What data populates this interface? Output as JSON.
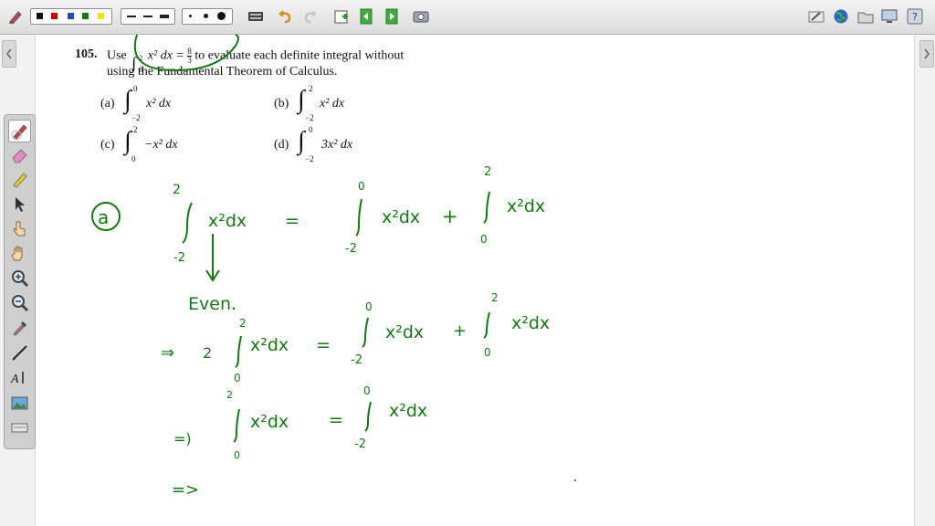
{
  "toolbar": {
    "pen_colors": [
      "#111111",
      "#d40000",
      "#1a4fbf",
      "#137a13",
      "#f2e600"
    ],
    "icons": [
      "pen-settings-icon",
      "keyboard-icon",
      "undo-icon",
      "redo-icon",
      "insert-page-icon",
      "page-back-icon",
      "page-forward-icon",
      "screen-capture-icon",
      "hide-screen-icon",
      "globe-icon",
      "folder-icon",
      "display-icon",
      "help-icon"
    ]
  },
  "side_tools": [
    "pen-icon",
    "eraser-icon",
    "highlighter-icon",
    "select-arrow-icon",
    "pointer-hand-icon",
    "pan-hand-icon",
    "zoom-in-icon",
    "zoom-out-icon",
    "eyedropper-icon",
    "line-icon",
    "text-tool-icon",
    "image-icon",
    "shape-icon"
  ],
  "problem": {
    "number": "105.",
    "line1_prefix": "Use",
    "given_sup": "2",
    "given_sub": "0",
    "given_expr": "x² dx =",
    "given_frac_num": "8",
    "given_frac_den": "3",
    "line1_suffix": "to evaluate each definite integral without",
    "line2": "using the Fundamental Theorem of Calculus.",
    "parts": [
      {
        "label": "(a)",
        "upper": "0",
        "lower": "−2",
        "expr": "x² dx"
      },
      {
        "label": "(b)",
        "upper": "2",
        "lower": "−2",
        "expr": "x² dx"
      },
      {
        "label": "(c)",
        "upper": "2",
        "lower": "0",
        "expr": "−x² dx"
      },
      {
        "label": "(d)",
        "upper": "0",
        "lower": "−2",
        "expr": "3x² dx"
      }
    ]
  },
  "handwriting": {
    "ink_color": "#117a11",
    "part_label": "a",
    "line1": {
      "lim1_upper": "2",
      "lim1_lower": "-2",
      "integrand1": "x²dx",
      "equals": "=",
      "lim2_upper": "0",
      "lim2_lower": "-2",
      "integrand2": "x²dx",
      "plus": "+",
      "lim3_upper": "2",
      "lim3_lower": "0",
      "integrand3": "x²dx"
    },
    "even_note": "Even.",
    "line2": {
      "implies": "⇒",
      "coef": "2",
      "lim1_upper": "2",
      "lim1_lower": "0",
      "integrand1": "x²dx",
      "equals": "=",
      "lim2_upper": "0",
      "lim2_lower": "-2",
      "integrand2": "x²dx",
      "plus": "+",
      "lim3_upper": "2",
      "lim3_lower": "0",
      "integrand3": "x²dx"
    },
    "line3": {
      "implies": "=)",
      "lim1_upper": "2",
      "lim1_lower": "0",
      "integrand1": "x²dx",
      "equals": "=",
      "lim2_upper": "0",
      "lim2_lower": "-2",
      "integrand2": "x²dx"
    },
    "line4": {
      "implies": "=>"
    }
  }
}
